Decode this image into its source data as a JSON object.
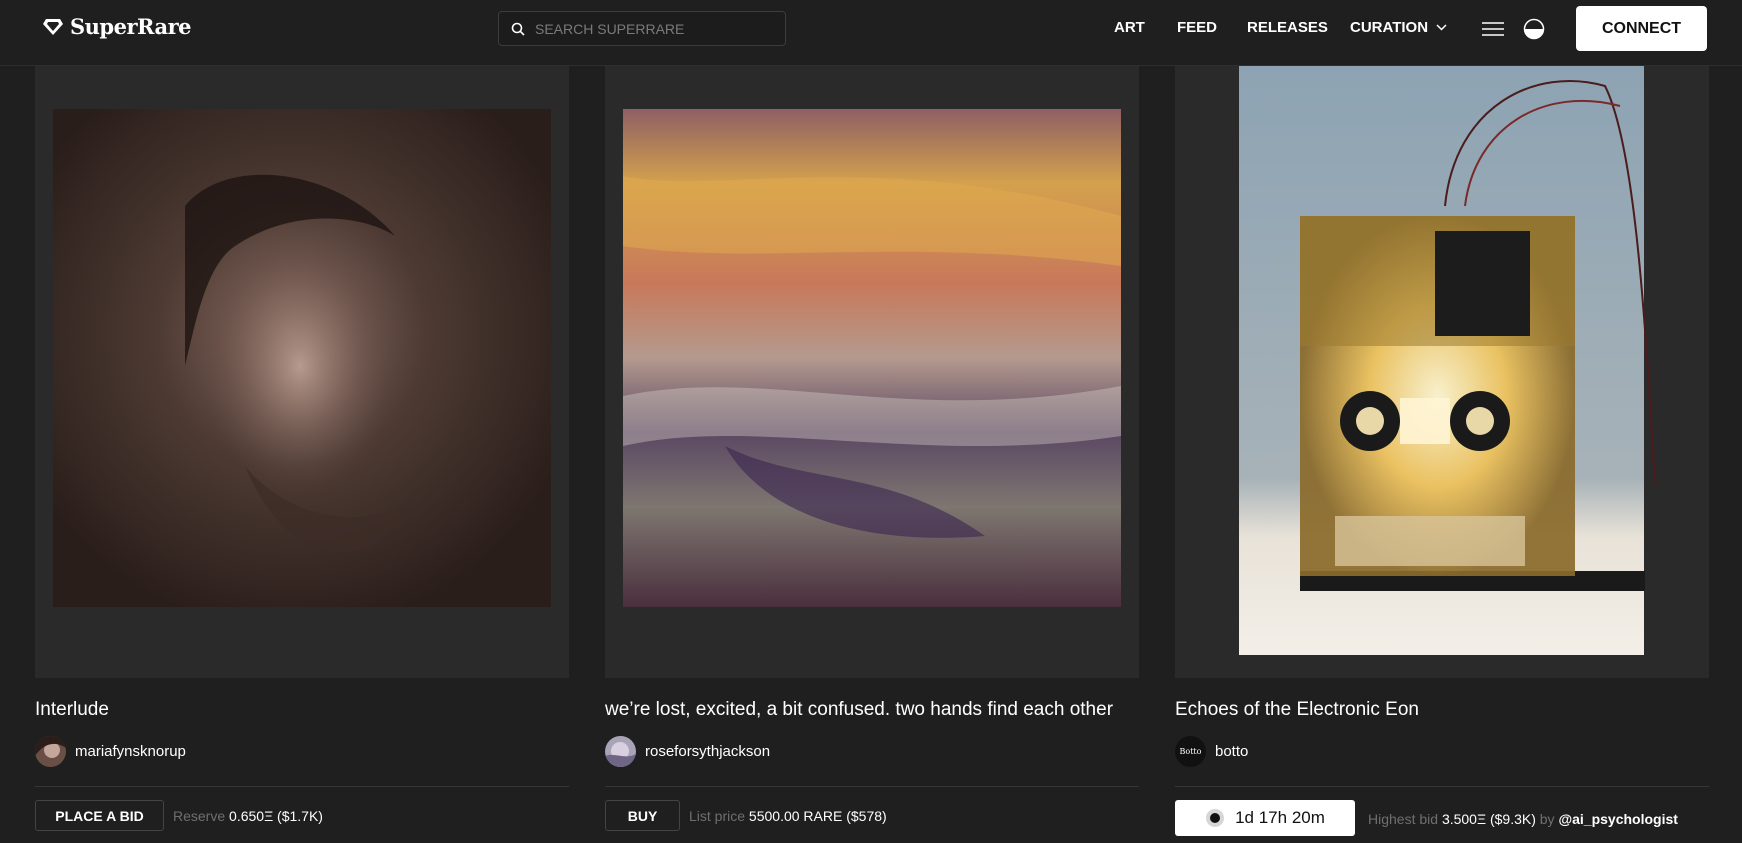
{
  "header": {
    "logo_text": "SuperRare",
    "search_placeholder": "SEARCH SUPERRARE",
    "nav": {
      "art": "ART",
      "feed": "FEED",
      "releases": "RELEASES",
      "curation": "CURATION"
    },
    "connect_label": "CONNECT"
  },
  "cards": [
    {
      "title": "Interlude",
      "artist": "mariafynsknorup",
      "action_label": "PLACE A BID",
      "price_label": "Reserve",
      "price_value": "0.650Ξ ($1.7K)"
    },
    {
      "title": "we’re lost, excited, a bit confused. two hands find each other",
      "artist": "roseforsythjackson",
      "action_label": "BUY",
      "price_label": "List price",
      "price_value": "5500.00 RARE ($578)"
    },
    {
      "title": "Echoes of the Electronic Eon",
      "artist": "botto",
      "avatar_text": "Botto",
      "timer": "1d 17h 20m",
      "price_label": "Highest bid",
      "price_value": "3.500Ξ ($9.3K)",
      "by_label": "by",
      "bidder": "@ai_psychologist"
    }
  ],
  "colors": {
    "background": "#1f1f1f",
    "card_bg": "#2a2a2a",
    "muted_text": "#6f6f6f"
  }
}
